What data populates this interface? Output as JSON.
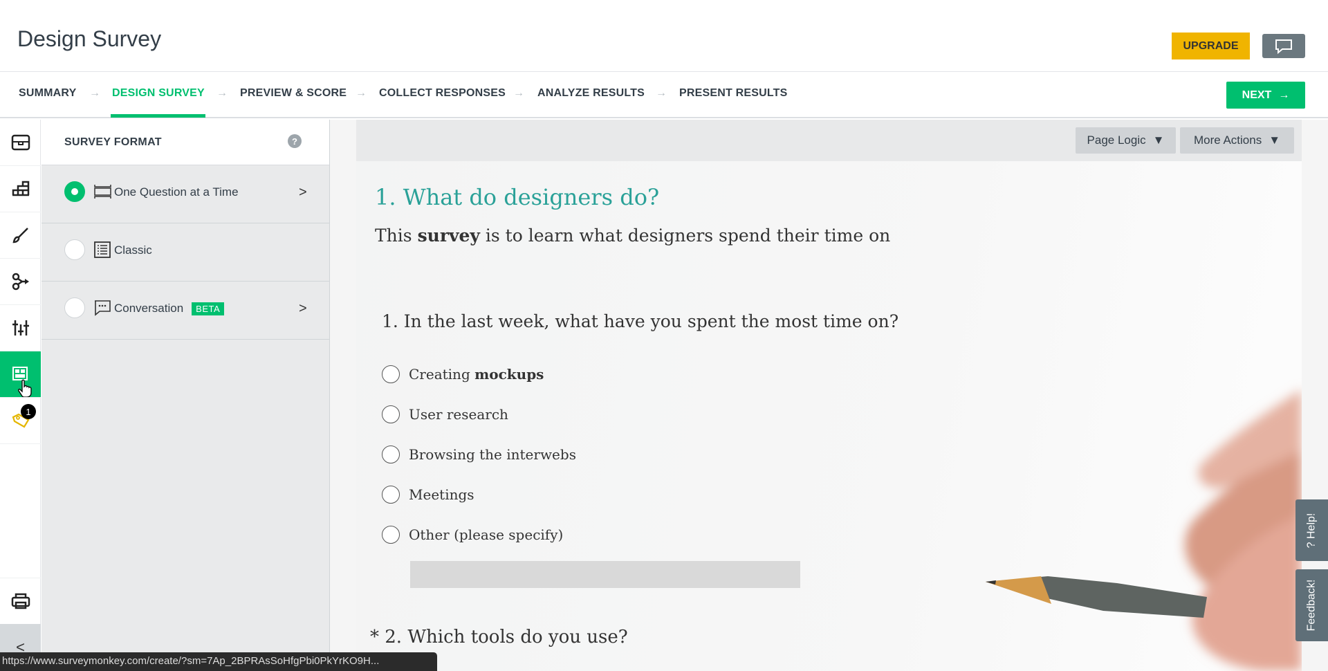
{
  "header": {
    "title": "Design Survey",
    "upgrade_label": "UPGRADE",
    "chat_icon": "speech-bubble-icon"
  },
  "nav": {
    "steps": [
      "SUMMARY",
      "DESIGN SURVEY",
      "PREVIEW & SCORE",
      "COLLECT RESPONSES",
      "ANALYZE RESULTS",
      "PRESENT RESULTS"
    ],
    "active_step": "DESIGN SURVEY",
    "next_label": "NEXT",
    "accent": "#00bf6f"
  },
  "rail": {
    "items": [
      "question-bank-icon",
      "builder-icon",
      "style-brush-icon",
      "logic-icon",
      "options-sliders-icon",
      "format-icon",
      "tag-icon"
    ],
    "active": "format-icon",
    "tag_badge": "1",
    "print_icon": "print-icon",
    "collapse_icon": "chevron-left-icon"
  },
  "panel": {
    "title": "SURVEY FORMAT",
    "help": "?",
    "formats": [
      {
        "label": "One Question at a Time",
        "selected": true
      },
      {
        "label": "Classic",
        "selected": false
      },
      {
        "label": "Conversation",
        "badge": "BETA",
        "selected": false
      }
    ]
  },
  "toolbar": {
    "page_logic": "Page Logic",
    "more_actions": "More Actions"
  },
  "survey": {
    "page_title": "1. What do designers do?",
    "desc_pre": "This ",
    "desc_bold": "survey",
    "desc_post": " is to learn what designers spend their time on",
    "q1": "1. In the last week, what have you spent the most time on?",
    "options": [
      {
        "pre": "Creating ",
        "bold": "mockups"
      },
      {
        "pre": "User research"
      },
      {
        "pre": "Browsing the interwebs"
      },
      {
        "pre": "Meetings"
      },
      {
        "pre": "Other (please specify)"
      }
    ],
    "q2": "* 2. Which tools do you use?",
    "title_color": "#2aa198"
  },
  "side_tabs": {
    "help": "Help!",
    "feedback": "Feedback!"
  },
  "status_url": "https://www.surveymonkey.com/create/?sm=7Ap_2BPRAsSoHfgPbi0PkYrKO9H..."
}
